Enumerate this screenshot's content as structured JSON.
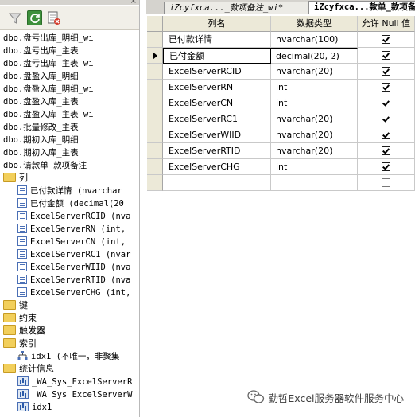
{
  "explorer": {
    "close_glyph": "×",
    "toolbar": {
      "filter_icon": "filter-icon",
      "refresh_icon": "refresh-icon",
      "report_icon": "report-icon"
    },
    "tree": [
      {
        "label": "dbo.盘亏出库_明细_wi",
        "icon": "none",
        "indent": 0,
        "mono": true
      },
      {
        "label": "dbo.盘亏出库_主表",
        "icon": "none",
        "indent": 0,
        "mono": true
      },
      {
        "label": "dbo.盘亏出库_主表_wi",
        "icon": "none",
        "indent": 0,
        "mono": true
      },
      {
        "label": "dbo.盘盈入库_明细",
        "icon": "none",
        "indent": 0,
        "mono": true
      },
      {
        "label": "dbo.盘盈入库_明细_wi",
        "icon": "none",
        "indent": 0,
        "mono": true
      },
      {
        "label": "dbo.盘盈入库_主表",
        "icon": "none",
        "indent": 0,
        "mono": true
      },
      {
        "label": "dbo.盘盈入库_主表_wi",
        "icon": "none",
        "indent": 0,
        "mono": true
      },
      {
        "label": "dbo.批量修改_主表",
        "icon": "none",
        "indent": 0,
        "mono": true
      },
      {
        "label": "dbo.期初入库_明细",
        "icon": "none",
        "indent": 0,
        "mono": true
      },
      {
        "label": "dbo.期初入库_主表",
        "icon": "none",
        "indent": 0,
        "mono": true
      },
      {
        "label": "dbo.请款单_款项备注",
        "icon": "none",
        "indent": 0,
        "mono": true
      },
      {
        "label": "列",
        "icon": "folder",
        "indent": 0,
        "mono": false
      },
      {
        "label": "已付款详情 (nvarchar",
        "icon": "col",
        "indent": 1,
        "mono": true
      },
      {
        "label": "已付金额 (decimal(20",
        "icon": "col",
        "indent": 1,
        "mono": true
      },
      {
        "label": "ExcelServerRCID (nva",
        "icon": "col",
        "indent": 1,
        "mono": true
      },
      {
        "label": "ExcelServerRN (int,",
        "icon": "col",
        "indent": 1,
        "mono": true
      },
      {
        "label": "ExcelServerCN (int,",
        "icon": "col",
        "indent": 1,
        "mono": true
      },
      {
        "label": "ExcelServerRC1 (nvar",
        "icon": "col",
        "indent": 1,
        "mono": true
      },
      {
        "label": "ExcelServerWIID (nva",
        "icon": "col",
        "indent": 1,
        "mono": true
      },
      {
        "label": "ExcelServerRTID (nva",
        "icon": "col",
        "indent": 1,
        "mono": true
      },
      {
        "label": "ExcelServerCHG (int,",
        "icon": "col",
        "indent": 1,
        "mono": true
      },
      {
        "label": "键",
        "icon": "folder",
        "indent": 0,
        "mono": false
      },
      {
        "label": "约束",
        "icon": "folder",
        "indent": 0,
        "mono": false
      },
      {
        "label": "触发器",
        "icon": "folder",
        "indent": 0,
        "mono": false
      },
      {
        "label": "索引",
        "icon": "folder",
        "indent": 0,
        "mono": false
      },
      {
        "label": "idx1 (不唯一，非聚集",
        "icon": "idx",
        "indent": 1,
        "mono": true
      },
      {
        "label": "统计信息",
        "icon": "folder",
        "indent": 0,
        "mono": false
      },
      {
        "label": "_WA_Sys_ExcelServerR",
        "icon": "stat",
        "indent": 1,
        "mono": true
      },
      {
        "label": "_WA_Sys_ExcelServerW",
        "icon": "stat",
        "indent": 1,
        "mono": true
      },
      {
        "label": "idx1",
        "icon": "stat",
        "indent": 1,
        "mono": true
      }
    ]
  },
  "tabs": {
    "inactive": "iZcyfxca..._款项备注_wi*",
    "active": "iZcyfxca...款单_款项备"
  },
  "grid": {
    "headers": {
      "name": "列名",
      "type": "数据类型",
      "null": "允许 Null 值"
    },
    "rows": [
      {
        "name": "已付款详情",
        "type": "nvarchar(100)",
        "allow_null": true,
        "selected": false
      },
      {
        "name": "已付金额",
        "type": "decimal(20, 2)",
        "allow_null": true,
        "selected": true
      },
      {
        "name": "ExcelServerRCID",
        "type": "nvarchar(20)",
        "allow_null": true,
        "selected": false
      },
      {
        "name": "ExcelServerRN",
        "type": "int",
        "allow_null": true,
        "selected": false
      },
      {
        "name": "ExcelServerCN",
        "type": "int",
        "allow_null": true,
        "selected": false
      },
      {
        "name": "ExcelServerRC1",
        "type": "nvarchar(20)",
        "allow_null": true,
        "selected": false
      },
      {
        "name": "ExcelServerWIID",
        "type": "nvarchar(20)",
        "allow_null": true,
        "selected": false
      },
      {
        "name": "ExcelServerRTID",
        "type": "nvarchar(20)",
        "allow_null": true,
        "selected": false
      },
      {
        "name": "ExcelServerCHG",
        "type": "int",
        "allow_null": true,
        "selected": false
      },
      {
        "name": "",
        "type": "",
        "allow_null": false,
        "selected": false
      }
    ]
  },
  "watermark": {
    "text": "勤哲Excel服务器软件服务中心",
    "icon": "wechat-icon"
  }
}
